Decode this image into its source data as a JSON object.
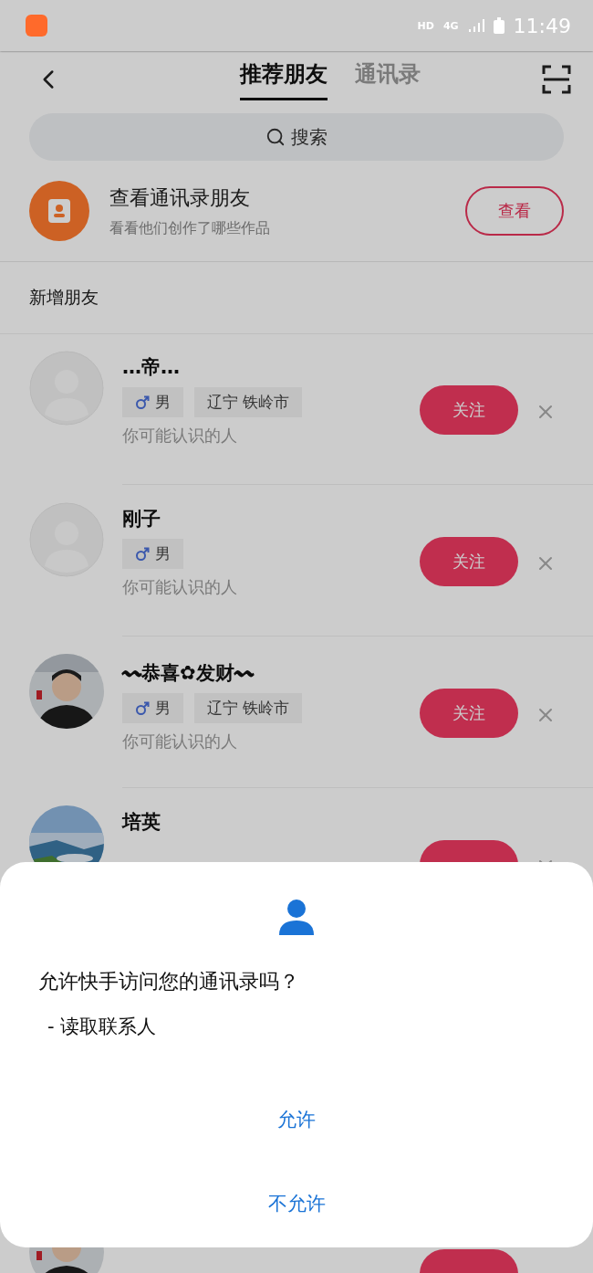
{
  "status_bar": {
    "hd": "HD",
    "network": "4G",
    "time": "11:49"
  },
  "header": {
    "tabs": [
      {
        "label": "推荐朋友",
        "selected": true
      },
      {
        "label": "通讯录",
        "selected": false
      }
    ]
  },
  "search": {
    "placeholder": "搜索"
  },
  "contacts_banner": {
    "title": "查看通讯录朋友",
    "subtitle": "看看他们创作了哪些作品",
    "button": "查看"
  },
  "section_title": "新增朋友",
  "friends": [
    {
      "name": "…帝…",
      "avatar": {
        "kind": "default"
      },
      "dismissable": true,
      "tags": [
        {
          "kind": "gender",
          "text": "男"
        },
        {
          "kind": "place",
          "text": "辽宁 铁岭市"
        }
      ],
      "reason": "你可能认识的人",
      "button": "关注"
    },
    {
      "name": "刚子",
      "avatar": {
        "kind": "default"
      },
      "dismissable": true,
      "tags": [
        {
          "kind": "gender",
          "text": "男"
        }
      ],
      "reason": "你可能认识的人",
      "button": "关注"
    },
    {
      "name": "〰恭喜✿发财〰",
      "dismissable": true,
      "tags": [
        {
          "kind": "gender",
          "text": "男"
        },
        {
          "kind": "place",
          "text": "辽宁 铁岭市"
        }
      ],
      "reason": "你可能认识的人",
      "button": "关注"
    },
    {
      "name": "培英",
      "dismissable": true
    },
    {
      "dismissable": false
    }
  ],
  "dialog": {
    "message": "允许快手访问您的通讯录吗？",
    "permission": "- 读取联系人",
    "buttons": [
      "允许",
      "不允许"
    ]
  }
}
